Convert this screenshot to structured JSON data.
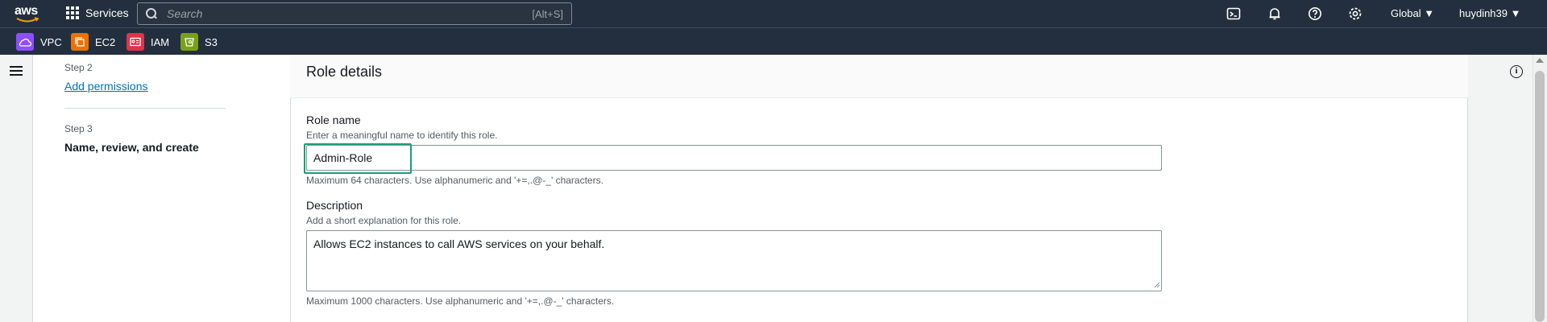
{
  "topnav": {
    "logo_text": "aws",
    "services_label": "Services",
    "search_placeholder": "Search",
    "search_shortcut": "[Alt+S]",
    "region_label": "Global ▼",
    "account_label": "huydinh39 ▼",
    "icons": [
      "cloudshell-icon",
      "notifications-icon",
      "help-icon",
      "settings-icon"
    ]
  },
  "favorites": [
    {
      "label": "VPC",
      "color": "#8c4fff",
      "icon": "vpc-icon"
    },
    {
      "label": "EC2",
      "color": "#ed7100",
      "icon": "ec2-icon"
    },
    {
      "label": "IAM",
      "color": "#dd344c",
      "icon": "iam-icon"
    },
    {
      "label": "S3",
      "color": "#7aa116",
      "icon": "s3-icon"
    }
  ],
  "steps": {
    "step2_label": "Step 2",
    "step2_link": "Add permissions",
    "step3_label": "Step 3",
    "step3_title": "Name, review, and create"
  },
  "role_details": {
    "title": "Role details",
    "role_name": {
      "label": "Role name",
      "description": "Enter a meaningful name to identify this role.",
      "value": "Admin-Role",
      "constraint": "Maximum 64 characters. Use alphanumeric and '+=,.@-_' characters."
    },
    "description": {
      "label": "Description",
      "description": "Add a short explanation for this role.",
      "value": "Allows EC2 instances to call AWS services on your behalf.",
      "constraint": "Maximum 1000 characters. Use alphanumeric and '+=,.@-_' characters."
    }
  },
  "colors": {
    "nav_bg": "#232f3e",
    "link": "#0073bb",
    "focus_highlight": "#1a9e7a"
  }
}
